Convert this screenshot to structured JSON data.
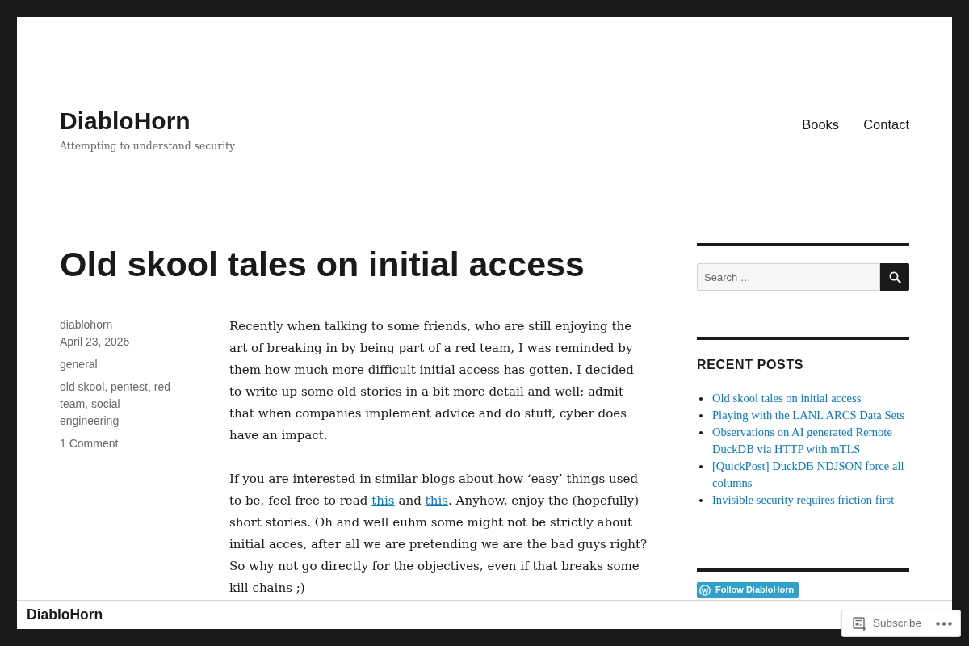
{
  "site": {
    "title": "DiabloHorn",
    "tagline": "Attempting to understand security"
  },
  "nav": [
    "Books",
    "Contact"
  ],
  "post": {
    "title": "Old skool tales on initial access",
    "meta": [
      [
        "diablohorn",
        "April 23, 2026"
      ],
      [
        "general"
      ],
      [
        "old skool, pentest, red team, social engineering"
      ],
      [
        "1 Comment"
      ]
    ],
    "paragraphs": [
      [
        {
          "kind": "text",
          "text": "Recently when talking to some friends, who are still enjoying the art of breaking in by being part of a red team, I was reminded by them how much more difficult initial access has gotten. I decided to write up some old stories in a bit more detail and well; admit that when companies implement advice and do stuff, cyber does have an impact."
        }
      ],
      [
        {
          "kind": "text",
          "text": "If you are interested in similar blogs about how ‘easy’ things used to be, feel free to read "
        },
        {
          "kind": "link",
          "text": "this"
        },
        {
          "kind": "text",
          "text": " and "
        },
        {
          "kind": "link",
          "text": "this"
        },
        {
          "kind": "text",
          "text": ". Anyhow, enjoy the (hopefully) short stories. Oh and well euhm some might not be strictly about initial acces, after all we are pretending we are the bad guys right? So why not go directly for the objectives, even if that breaks some kill chains ;)"
        }
      ]
    ]
  },
  "sidebar": {
    "search": {
      "placeholder": "Search …"
    },
    "recent_posts": {
      "heading": "RECENT POSTS",
      "items": [
        "Old skool tales on initial access",
        "Playing with the LANL ARCS Data Sets",
        "Observations on AI generated Remote DuckDB via HTTP with mTLS",
        "[QuickPost] DuckDB NDJSON force all columns",
        "Invisible security requires friction first"
      ]
    },
    "follow_button": {
      "label": "Follow DiabloHorn"
    }
  },
  "bottom_bar": {
    "title": "DiabloHorn",
    "subscribe": {
      "label": "Subscribe"
    }
  }
}
